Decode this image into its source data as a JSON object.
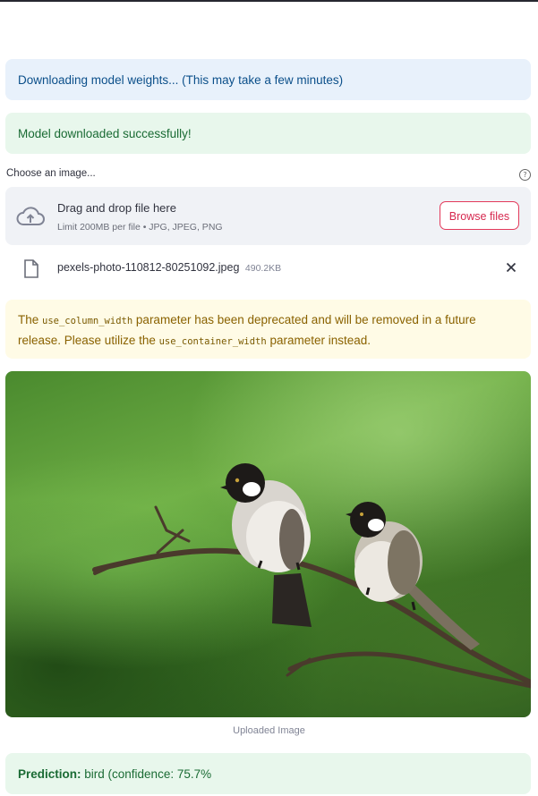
{
  "alerts": {
    "info": "Downloading model weights... (This may take a few minutes)",
    "success": "Model downloaded successfully!",
    "warning": {
      "part1": "The ",
      "code1": "use_column_width",
      "part2": " parameter has been deprecated and will be removed in a future release. Please utilize the ",
      "code2": "use_container_width",
      "part3": " parameter instead."
    },
    "prediction": {
      "label": "Prediction:",
      "text": " bird (confidence: 75.7%"
    }
  },
  "uploader": {
    "label": "Choose an image...",
    "help_icon": "question-circle-icon",
    "drop_title": "Drag and drop file here",
    "limit_text": "Limit 200MB per file • JPG, JPEG, PNG",
    "browse_label": "Browse files",
    "upload_icon": "cloud-upload-icon"
  },
  "file": {
    "icon": "file-icon",
    "name": "pexels-photo-110812-80251092.jpeg",
    "size": "490.2KB",
    "remove_icon": "close-icon"
  },
  "image": {
    "caption": "Uploaded Image"
  },
  "colors": {
    "info_bg": "#e8f1fb",
    "success_bg": "#e8f7ec",
    "warning_bg": "#fffbe6",
    "accent": "#e3395a"
  }
}
